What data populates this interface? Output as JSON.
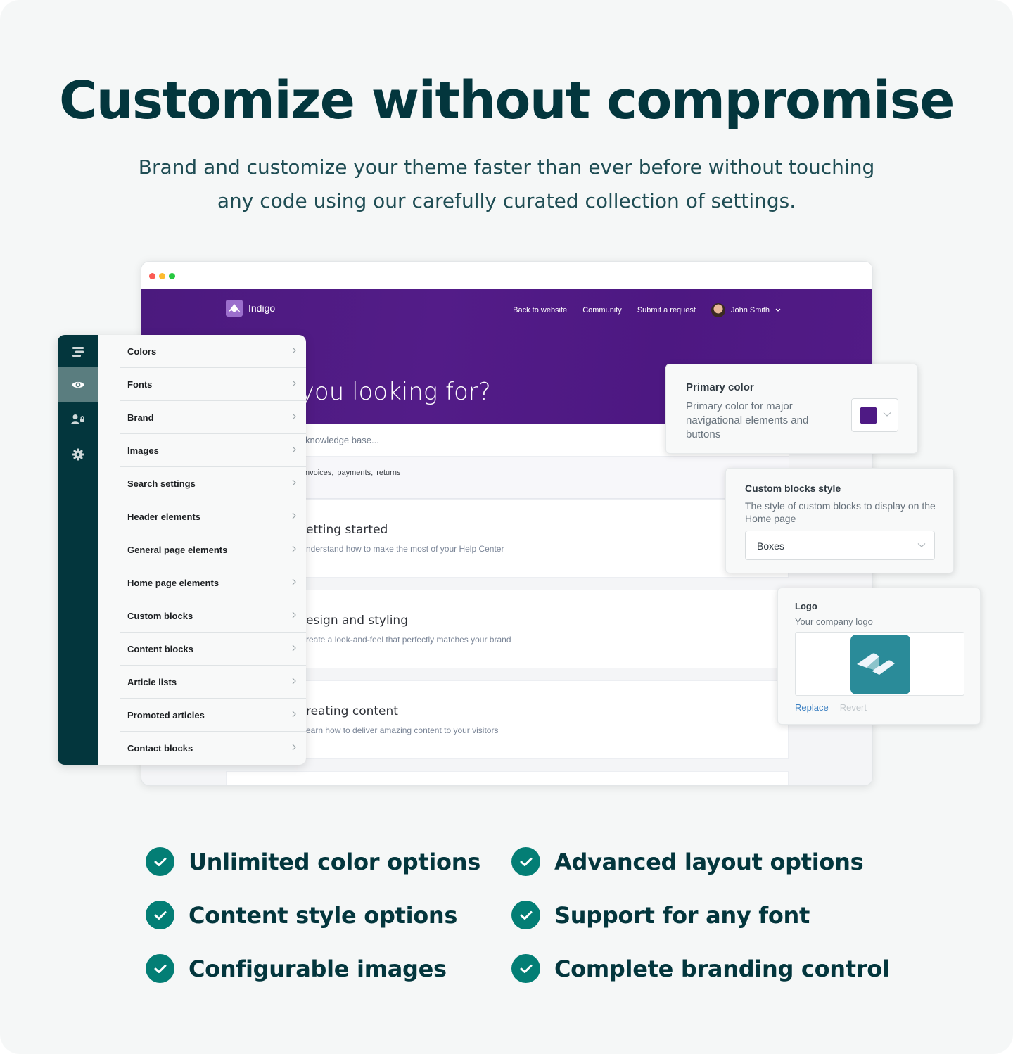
{
  "colors": {
    "heading": "#03363d",
    "hero_purple": "#4e1a84",
    "primary_swatch": "#4e1a84",
    "rail": "#03363d",
    "check": "#037e75",
    "logo_tile": "#2a8b99"
  },
  "header": {
    "title": "Customize without compromise",
    "subtitle": "Brand and customize your theme faster than ever before without touching any code using our carefully curated collection of settings."
  },
  "browser": {
    "site": {
      "brand_name": "Indigo",
      "nav": [
        "Back to website",
        "Community",
        "Submit a request"
      ],
      "user_name": "John Smith",
      "hero_title": "are you looking for?",
      "search_placeholder": "knowledge base...",
      "tags": "nvoices,  payments,  returns",
      "cards": [
        {
          "title": "etting started",
          "desc": "nderstand how to make the most of your Help Center"
        },
        {
          "title": "esign and styling",
          "desc": "reate a look-and-feel that perfectly matches your brand"
        },
        {
          "title": "reating content",
          "desc": "earn how to deliver amazing content to your visitors"
        }
      ]
    }
  },
  "settings": {
    "rail": [
      {
        "icon": "list-icon",
        "active": false
      },
      {
        "icon": "eye-icon",
        "active": true
      },
      {
        "icon": "user-lock-icon",
        "active": false
      },
      {
        "icon": "gear-icon",
        "active": false
      }
    ],
    "menu": [
      "Colors",
      "Fonts",
      "Brand",
      "Images",
      "Search settings",
      "Header elements",
      "General page elements",
      "Home page elements",
      "Custom blocks",
      "Content blocks",
      "Article lists",
      "Promoted articles",
      "Contact blocks"
    ]
  },
  "panels": {
    "primary_color": {
      "title": "Primary color",
      "description": "Primary color for major navigational elements and buttons",
      "value": "#4e1a84"
    },
    "custom_blocks": {
      "title": "Custom blocks style",
      "description": "The style of custom blocks to display on the Home page",
      "selected": "Boxes"
    },
    "logo": {
      "title": "Logo",
      "description": "Your company logo",
      "replace_label": "Replace",
      "revert_label": "Revert"
    }
  },
  "features": [
    "Unlimited color options",
    "Content style options",
    "Configurable images",
    "Advanced layout options",
    "Support for any font",
    "Complete branding control"
  ]
}
